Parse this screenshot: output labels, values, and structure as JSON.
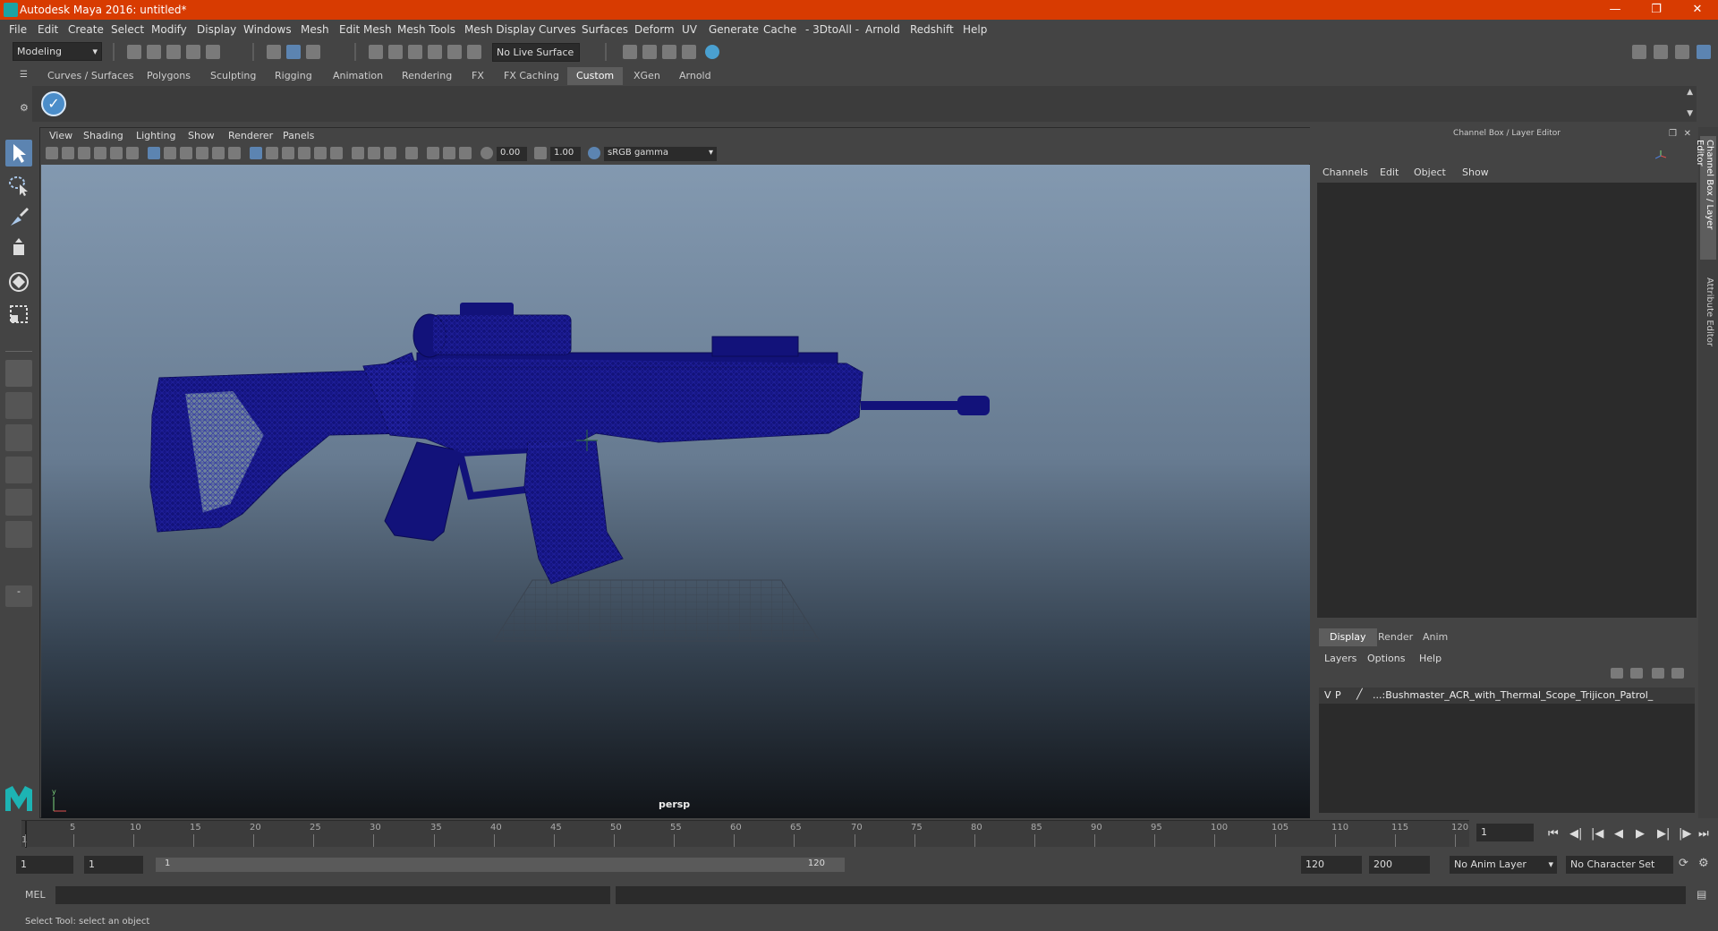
{
  "window": {
    "title": "Autodesk Maya 2016: untitled*"
  },
  "menu": [
    "File",
    "Edit",
    "Create",
    "Select",
    "Modify",
    "Display",
    "Windows",
    "Mesh",
    "Edit Mesh",
    "Mesh Tools",
    "Mesh Display",
    "Curves",
    "Surfaces",
    "Deform",
    "UV",
    "Generate",
    "Cache",
    "- 3DtoAll -",
    "Arnold",
    "Redshift",
    "Help"
  ],
  "status": {
    "mode": "Modeling",
    "live_surface": "No Live Surface"
  },
  "shelf_tabs": [
    "Curves / Surfaces",
    "Polygons",
    "Sculpting",
    "Rigging",
    "Animation",
    "Rendering",
    "FX",
    "FX Caching",
    "Custom",
    "XGen",
    "Arnold"
  ],
  "shelf_active": "Custom",
  "viewport": {
    "menu": [
      "View",
      "Shading",
      "Lighting",
      "Show",
      "Renderer",
      "Panels"
    ],
    "exposure": "0.00",
    "gamma": "1.00",
    "color_space": "sRGB gamma",
    "camera_label": "persp",
    "model_color": "#12127a"
  },
  "channel_box": {
    "title": "Channel Box / Layer Editor",
    "menu": [
      "Channels",
      "Edit",
      "Object",
      "Show"
    ],
    "layer_tabs": [
      "Display",
      "Render",
      "Anim"
    ],
    "layer_menu": [
      "Layers",
      "Options",
      "Help"
    ],
    "layer": {
      "v": "V",
      "p": "P",
      "name": "...:Bushmaster_ACR_with_Thermal_Scope_Trijicon_Patrol_"
    }
  },
  "side_tabs": [
    "Channel Box / Layer Editor",
    "Attribute Editor"
  ],
  "timeline": {
    "ticks": [
      "1",
      "5",
      "10",
      "15",
      "20",
      "25",
      "30",
      "35",
      "40",
      "45",
      "50",
      "55",
      "60",
      "65",
      "70",
      "75",
      "80",
      "85",
      "90",
      "95",
      "100",
      "105",
      "110",
      "115",
      "120"
    ],
    "current_frame": "1"
  },
  "range": {
    "start": "1",
    "playback_start": "1",
    "slider_start": "1",
    "slider_end": "120",
    "playback_end": "120",
    "end": "200",
    "anim_layer": "No Anim Layer",
    "character_set": "No Character Set"
  },
  "command": {
    "label": "MEL"
  },
  "help_line": "Select Tool: select an object"
}
